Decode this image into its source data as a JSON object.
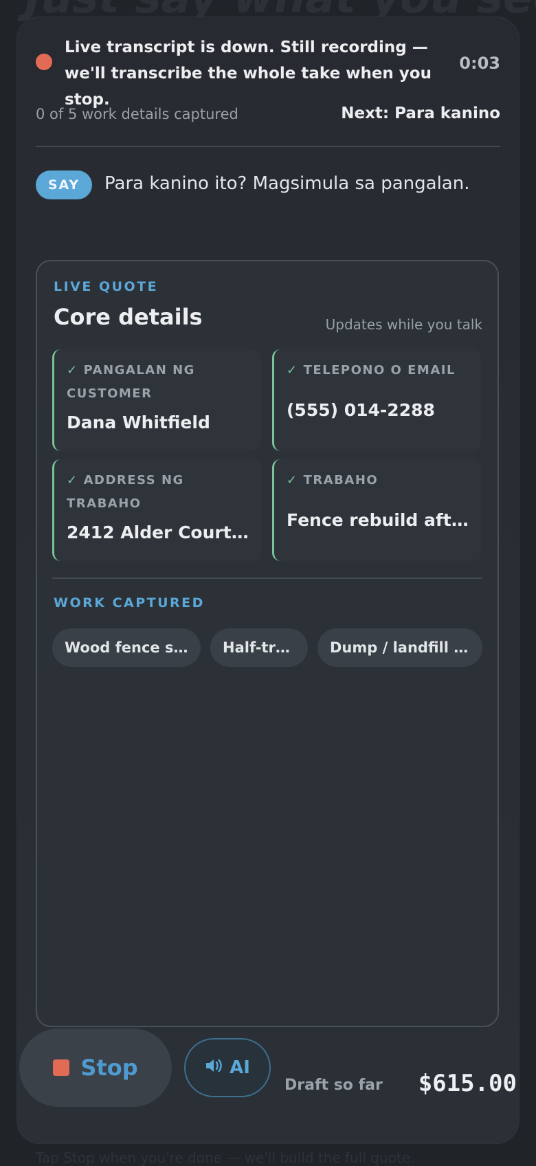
{
  "background": {
    "title": "Just say what you see",
    "footer": "Tap Stop when you're done — we'll build the full quote."
  },
  "status": {
    "message": "Live transcript is down. Still recording — we'll transcribe the whole take when you stop.",
    "timer": "0:03",
    "dot_color": "#e26b55"
  },
  "progress": {
    "text": "0 of 5 work details captured",
    "next": "Next: Para kanino"
  },
  "prompt": {
    "badge": "SAY",
    "text": "Para kanino ito? Magsimula sa pangalan."
  },
  "quote": {
    "eyebrow": "LIVE QUOTE",
    "title": "Core details",
    "hint": "Updates while you talk",
    "fields": [
      {
        "check": "✓",
        "label": "PANGALAN NG CUSTOMER",
        "value": "Dana Whitfield"
      },
      {
        "check": "✓",
        "label": "TELEPONO O EMAIL",
        "value": "(555) 014-2288"
      },
      {
        "check": "✓",
        "label": "ADDRESS NG TRABAHO",
        "value": "2412 Alder Court, ..."
      },
      {
        "check": "✓",
        "label": "TRABAHO",
        "value": "Fence rebuild afte..."
      }
    ],
    "work_eyebrow": "WORK CAPTURED",
    "work_items": [
      "Wood fence se...",
      "Half-tru...",
      "Dump / landfill fe..."
    ]
  },
  "controls": {
    "stop_label": "Stop",
    "stop_icon": "stop-square-icon",
    "ai_icon": "speaker-icon",
    "ai_label": "AI",
    "draft_label": "Draft so far",
    "draft_amount": "$615.00"
  },
  "colors": {
    "accent": "#5ba7d8",
    "success": "#79c49a",
    "danger": "#e26b55"
  }
}
